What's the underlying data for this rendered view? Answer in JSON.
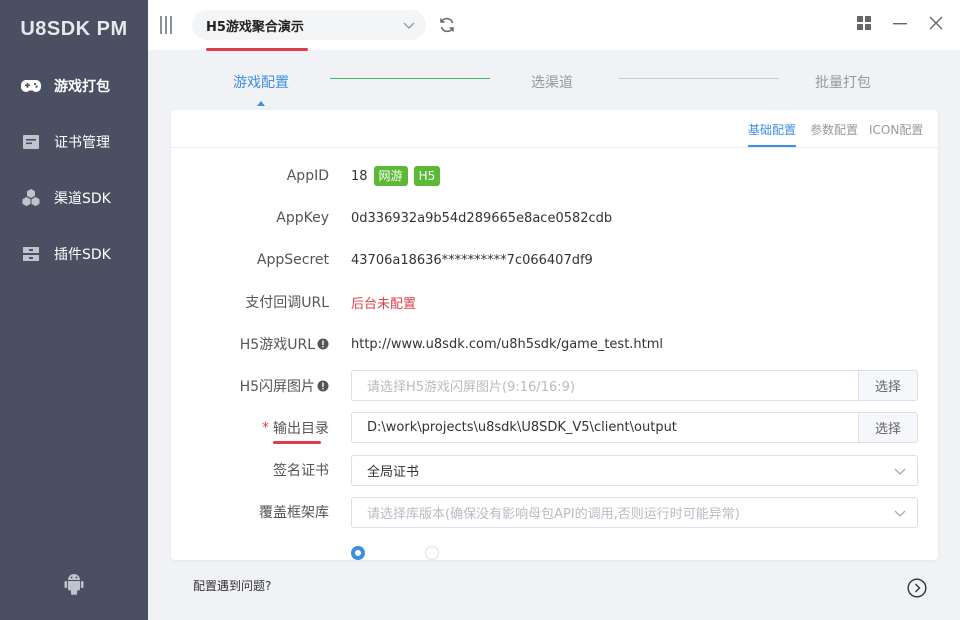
{
  "app": {
    "brand": "U8SDK PM"
  },
  "sidebar": {
    "items": [
      {
        "label": "游戏打包",
        "icon": "gamepad-icon"
      },
      {
        "label": "证书管理",
        "icon": "certificate-icon"
      },
      {
        "label": "渠道SDK",
        "icon": "cubes-icon"
      },
      {
        "label": "插件SDK",
        "icon": "plugin-icon"
      }
    ],
    "active_index": 0,
    "footer_icon": "android-icon"
  },
  "topbar": {
    "project": "H5游戏聚合演示"
  },
  "steps": [
    {
      "label": "游戏配置"
    },
    {
      "label": "选渠道"
    },
    {
      "label": "批量打包"
    }
  ],
  "subtabs": [
    {
      "label": "基础配置"
    },
    {
      "label": "参数配置"
    },
    {
      "label": "ICON配置"
    }
  ],
  "form": {
    "appid": {
      "label": "AppID",
      "value": "18",
      "tags": [
        "网游",
        "H5"
      ]
    },
    "appkey": {
      "label": "AppKey",
      "value": "0d336932a9b54d289665e8ace0582cdb"
    },
    "appsecret": {
      "label": "AppSecret",
      "value": "43706a18636**********7c066407df9"
    },
    "pay_callback": {
      "label": "支付回调URL",
      "value": "后台未配置"
    },
    "h5_url": {
      "label": "H5游戏URL",
      "value": "http://www.u8sdk.com/u8h5sdk/game_test.html"
    },
    "h5_splash": {
      "label": "H5闪屏图片",
      "placeholder": "请选择H5游戏闪屏图片(9:16/16:9)",
      "button": "选择"
    },
    "output_dir": {
      "required_mark": "*",
      "label": "输出目录",
      "value": "D:\\work\\projects\\u8sdk\\U8SDK_V5\\client\\output",
      "button": "选择"
    },
    "sign_cert": {
      "label": "签名证书",
      "value": "全局证书"
    },
    "framework": {
      "label": "覆盖框架库",
      "placeholder": "请选择库版本(确保没有影响母包API的调用,否则运行时可能异常)"
    }
  },
  "footer": {
    "help": "配置遇到问题?"
  },
  "colors": {
    "sidebar_bg": "#4a4f61",
    "accent": "#3b8fe3",
    "tag_green": "#5cb936",
    "error_red": "#e0404a"
  }
}
